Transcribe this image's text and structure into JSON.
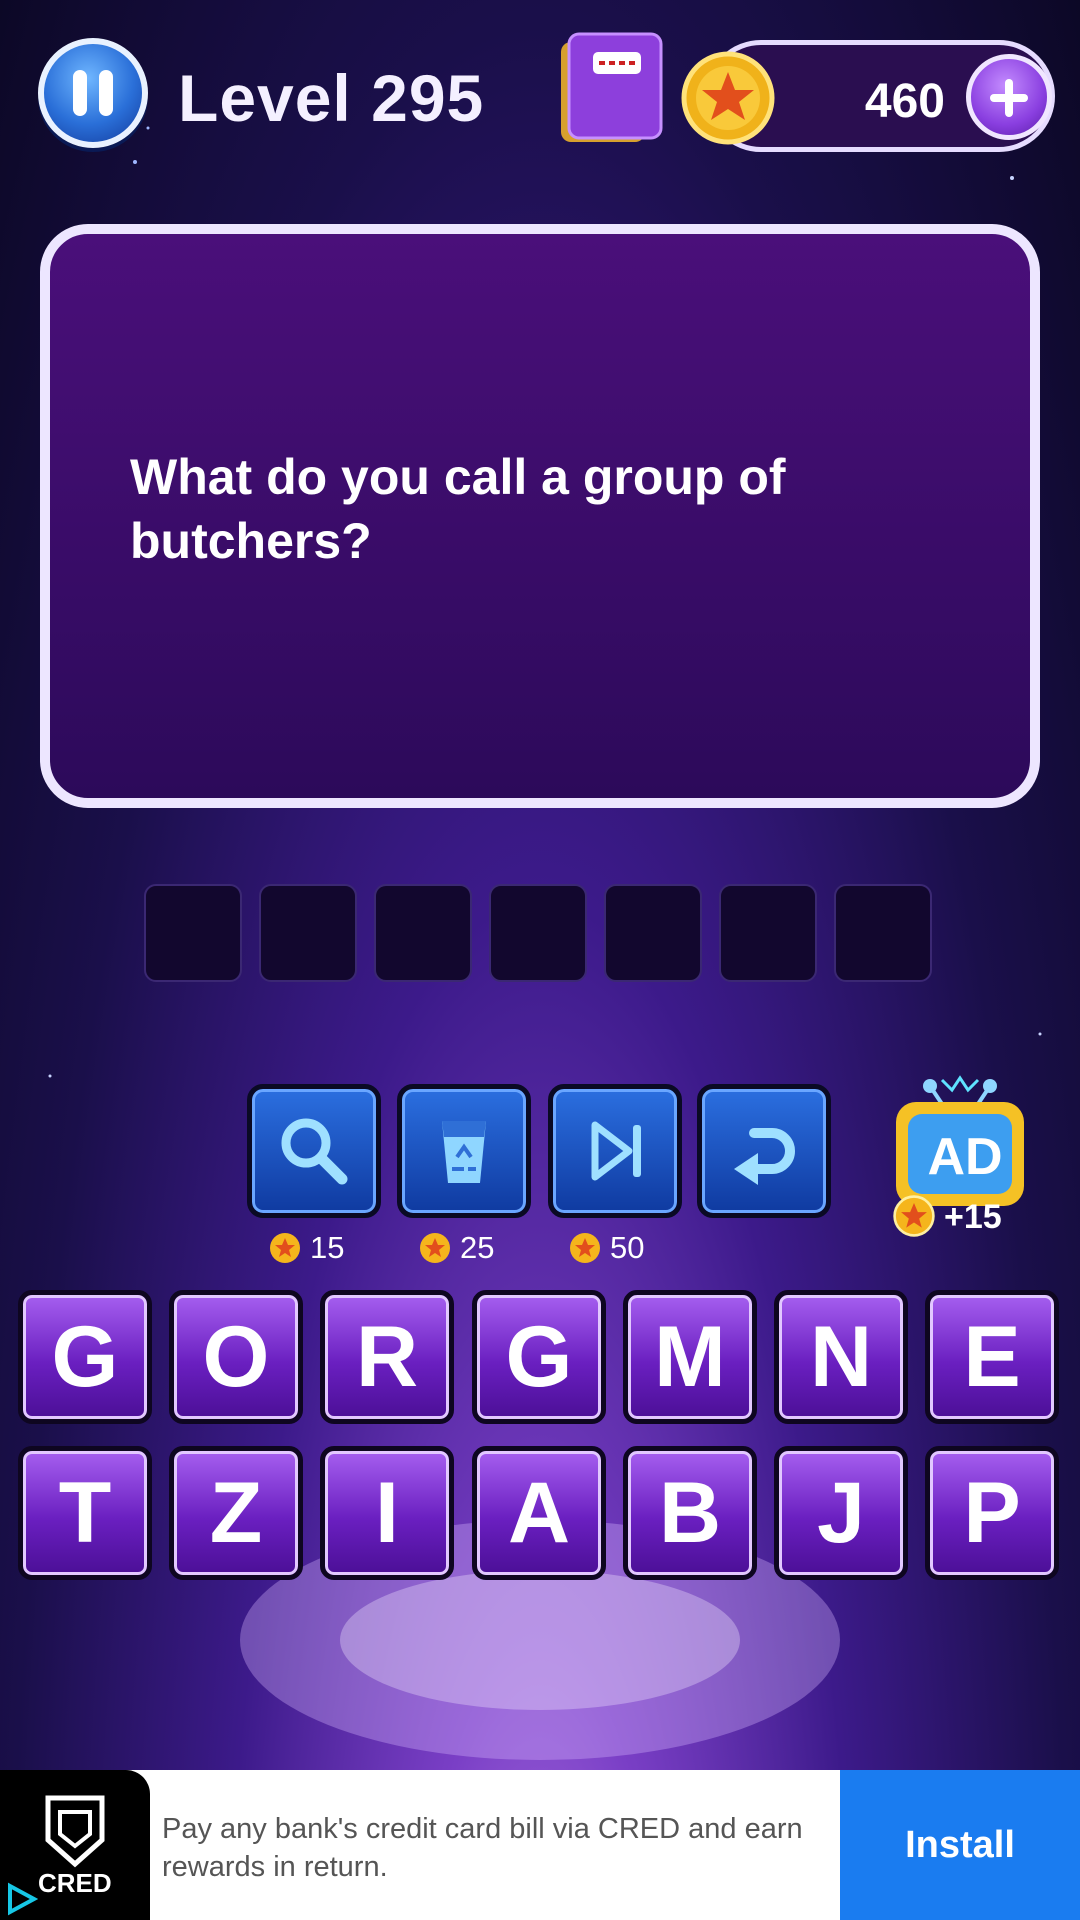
{
  "header": {
    "level_label": "Level 295",
    "coins": "460"
  },
  "question": {
    "text": "What do you call a group of butchers?"
  },
  "answer_slots": [
    "",
    "",
    "",
    "",
    "",
    "",
    ""
  ],
  "tools": [
    {
      "icon": "magnifier-icon",
      "cost": "15"
    },
    {
      "icon": "trash-recycle-icon",
      "cost": "25"
    },
    {
      "icon": "skip-icon",
      "cost": "50"
    },
    {
      "icon": "undo-icon"
    }
  ],
  "ad_reward": {
    "label": "AD",
    "reward": "+15"
  },
  "letters_row1": [
    "G",
    "O",
    "R",
    "G",
    "M",
    "N",
    "E"
  ],
  "letters_row2": [
    "T",
    "Z",
    "I",
    "A",
    "B",
    "J",
    "P"
  ],
  "banner_ad": {
    "brand": "CRED",
    "text": "Pay any bank's credit card bill via CRED and earn rewards in return.",
    "cta": "Install"
  },
  "colors": {
    "accent_purple": "#7a3fc6",
    "tool_blue": "#2b6fe0",
    "install_blue": "#1a7cf0"
  }
}
